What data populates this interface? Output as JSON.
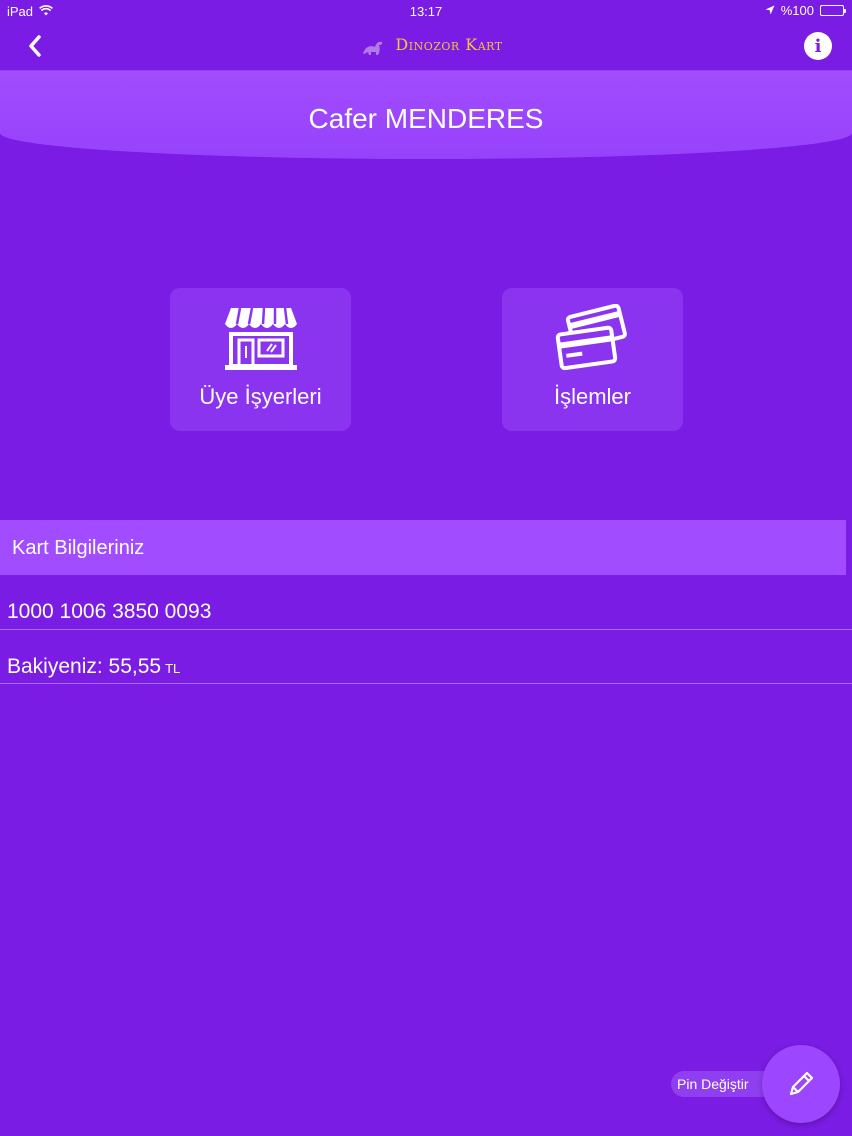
{
  "status_bar": {
    "carrier": "iPad",
    "time": "13:17",
    "battery_text": "%100"
  },
  "nav": {
    "logo_text": "Dinozor Kart",
    "back_icon": "chevron-left-icon",
    "info_icon": "info-icon",
    "info_glyph": "i"
  },
  "user": {
    "name": "Cafer MENDERES"
  },
  "tiles": [
    {
      "label": "Üye İşyerleri",
      "icon": "storefront-icon"
    },
    {
      "label": "İşlemler",
      "icon": "credit-cards-icon"
    }
  ],
  "card_info": {
    "title": "Kart Bilgileriniz",
    "card_number": "1000 1006 3850 0093",
    "balance_label": "Bakiyeniz: 55,55",
    "currency": "TL"
  },
  "fab": {
    "label": "Pin Değiştir",
    "icon": "pencil-icon"
  },
  "colors": {
    "background": "#7a1ce3",
    "header": "#a24cff",
    "tile": "#8b34f0",
    "logo": "#f5c242",
    "battery": "#4cd964"
  }
}
